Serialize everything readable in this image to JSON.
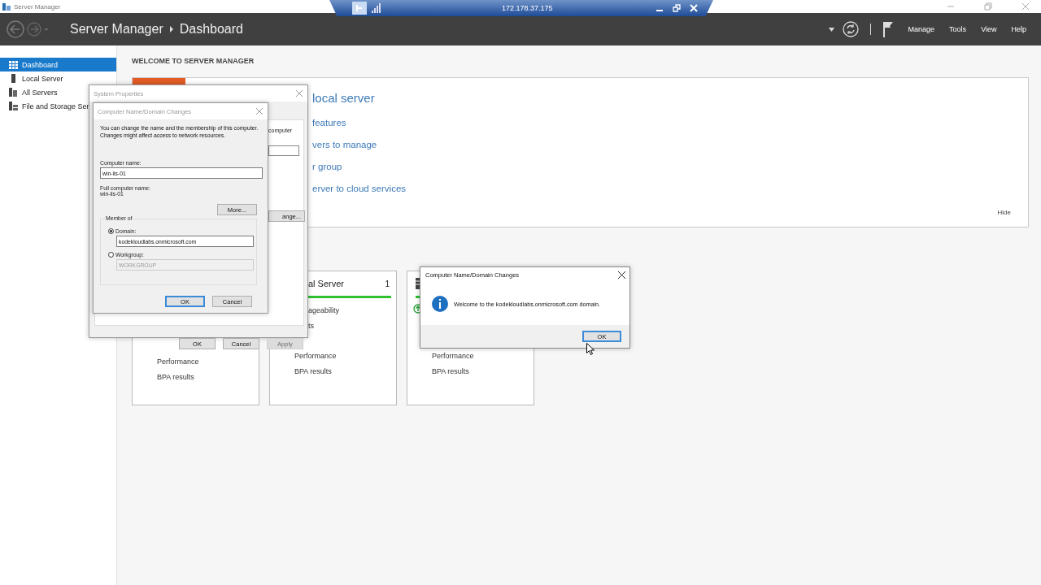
{
  "window": {
    "title": "Server Manager"
  },
  "connection_bar": {
    "address": "172.178.37.175"
  },
  "header": {
    "breadcrumb": [
      "Server Manager",
      "Dashboard"
    ],
    "menu": [
      "Manage",
      "Tools",
      "View",
      "Help"
    ]
  },
  "sidebar": {
    "items": [
      {
        "label": "Dashboard",
        "selected": true,
        "kind": "dashboard"
      },
      {
        "label": "Local Server",
        "selected": false,
        "kind": "server"
      },
      {
        "label": "All Servers",
        "selected": false,
        "kind": "servers"
      },
      {
        "label": "File and Storage Ser",
        "selected": false,
        "kind": "storage"
      }
    ]
  },
  "welcome": {
    "heading": "WELCOME TO SERVER MANAGER",
    "title": "local server",
    "links": [
      "features",
      "vers to manage",
      "r group",
      "erver to cloud services"
    ],
    "hide": "Hide"
  },
  "tiles": [
    {
      "kind": "covered",
      "items": [
        "Performance",
        "BPA results"
      ]
    },
    {
      "kind": "server",
      "title": "al Server",
      "count": "1",
      "items": [
        "ageability",
        "ts",
        "Performance",
        "BPA results"
      ]
    },
    {
      "kind": "group",
      "items": [
        "Performance",
        "BPA results"
      ]
    }
  ],
  "system_properties": {
    "title": "System Properties",
    "tab_text": "computer",
    "tab_button": "ange...",
    "buttons": [
      {
        "label": "OK",
        "disabled": false
      },
      {
        "label": "Cancel",
        "disabled": false
      },
      {
        "label": "Apply",
        "disabled": true
      }
    ]
  },
  "name_dialog": {
    "title": "Computer Name/Domain Changes",
    "intro": "You can change the name and the membership of this computer. Changes might affect access to network resources.",
    "computer_name_label": "Computer name:",
    "computer_name": "win-iis-01",
    "full_name_label": "Full computer name:",
    "full_name": "win-iis-01",
    "more_button": "More...",
    "member_of": "Member of",
    "options": [
      {
        "label": "Domain:",
        "selected": true,
        "value": "kodekloudlabs.onmicrosoft.com"
      },
      {
        "label": "Workgroup:",
        "selected": false,
        "value": "WORKGROUP"
      }
    ],
    "buttons": [
      "OK",
      "Cancel"
    ]
  },
  "message_box": {
    "title": "Computer Name/Domain Changes",
    "message": "Welcome to the kodekloudlabs.onmicrosoft.com domain.",
    "button": "OK"
  }
}
